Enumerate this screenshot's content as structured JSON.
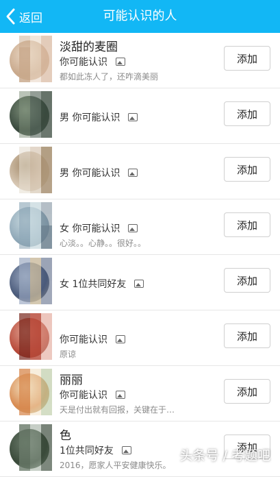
{
  "header": {
    "back_label": "返回",
    "title": "可能认识的人",
    "color": "#12b7f5"
  },
  "people": [
    {
      "name": "淡甜的麦圈",
      "info": "你可能认识",
      "sig": "都如此冻人了，还咋滴美丽",
      "button": "添加",
      "colors": [
        "#c9a98c",
        "#e9d7c4",
        "#d9b9a0"
      ]
    },
    {
      "name": "",
      "info": "男 你可能认识",
      "sig": "",
      "button": "添加",
      "colors": [
        "#3a4a3e",
        "#7e8f7a",
        "#5a6a60"
      ]
    },
    {
      "name": "",
      "info": "男 你可能认识",
      "sig": "",
      "button": "添加",
      "colors": [
        "#d7c7b3",
        "#a38a6a",
        "#e6dfd2"
      ]
    },
    {
      "name": "",
      "info": "女 你可能认识",
      "sig": "心淡。。心静。。很好。。",
      "button": "添加",
      "colors": [
        "#8fa8b8",
        "#c8d9df",
        "#6b7f8e"
      ]
    },
    {
      "name": "",
      "info": "女 1位共同好友",
      "sig": "",
      "button": "添加",
      "colors": [
        "#4a5a7a",
        "#9aa8c0",
        "#c8b89a"
      ]
    },
    {
      "name": "",
      "info": "你可能认识",
      "sig": "原谅",
      "button": "添加",
      "colors": [
        "#b84a3a",
        "#e0a090",
        "#7a2a20"
      ]
    },
    {
      "name": "丽丽",
      "info": "你可能认识",
      "sig": "天是付出就有回报，关键在于…",
      "button": "添加",
      "colors": [
        "#d88a50",
        "#f2e0c0",
        "#b8c8a0"
      ]
    },
    {
      "name": "色",
      "info": "1位共同好友",
      "sig": "2016，愿家人平安健康快乐。",
      "button": "添加",
      "colors": [
        "#3a4a3a",
        "#6a7a6a",
        "#9aa89a"
      ]
    }
  ],
  "watermark": "头条号 / 考题吧"
}
